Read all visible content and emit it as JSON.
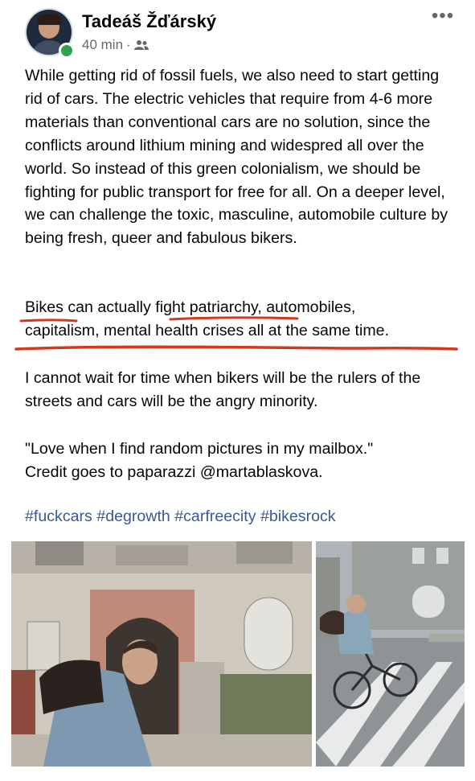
{
  "post": {
    "author": "Tadeáš Žďárský",
    "time": "40 min",
    "separator": "·",
    "audience_icon": "friends-icon",
    "more_icon": "more-options-icon"
  },
  "body": {
    "p1": "While getting rid of fossil fuels, we also need to start getting rid of cars. The electric vehicles that require from 4-6 more materials than conventional cars are no solution, since the conflicts around lithium mining and widespred all over the world. So instead of this green colonialism, we should be fighting for public transport for free for all. On a deeper level, we can challenge the toxic, masculine, automobile culture by being fresh, queer and fabulous bikers.",
    "p2_line1": "Bikes can actually fight patriarchy, automobiles,",
    "p2_line2": "capitalism, mental health crises all at the same time.",
    "p3": "I cannot wait for time when bikers will be the rulers of the streets and cars will be the angry minority.",
    "p4_line1": "\"Love when I find random pictures in my mailbox.\"",
    "p4_line2": "Credit goes to paparazzi @martablaskova.",
    "hashtags": "#fuckcars #degrowth #carfreecity #bikesrock"
  },
  "colors": {
    "text": "#050505",
    "secondary": "#65676b",
    "hashtag": "#385898",
    "underline": "#d23a1f",
    "online": "#31a24c"
  },
  "photos": [
    "photo-man-on-bike-building",
    "photo-cyclist-crosswalk"
  ]
}
